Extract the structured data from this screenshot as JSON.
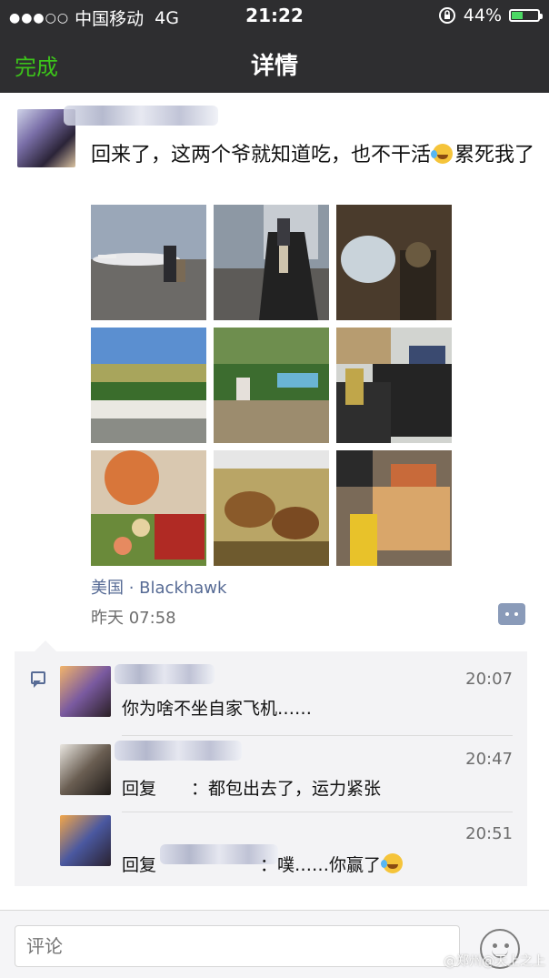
{
  "status_bar": {
    "signal": "●●●○○",
    "carrier": "中国移动",
    "network": "4G",
    "time": "21:22",
    "battery_percent": "44%",
    "battery_level": 0.44,
    "lock_icon": "orientation-lock-icon"
  },
  "nav": {
    "done_label": "完成",
    "title": "详情"
  },
  "post": {
    "text_part1": "回来了，这两个爷就知道吃，也不干活",
    "text_part2": "累死我了",
    "photos": [
      "jet-on-tarmac-photo",
      "jet-stairs-photo",
      "jet-window-photo",
      "hill-view-photo",
      "garden-pool-photo",
      "sofa-kids-photo",
      "pizza-fruit-photo",
      "crabs-tank-photo",
      "groceries-eggs-photo"
    ],
    "location": "美国 · Blackhawk",
    "time": "昨天 07:58"
  },
  "comments": [
    {
      "text": "你为啥不坐自家飞机……",
      "time": "20:07"
    },
    {
      "text": "回复　　：都包出去了，运力紧张",
      "time": "20:47"
    },
    {
      "text": "回复　　　　　　：噗……你赢了",
      "time": "20:51"
    }
  ],
  "input": {
    "placeholder": "评论"
  },
  "watermark": "@郑州@天上之上"
}
